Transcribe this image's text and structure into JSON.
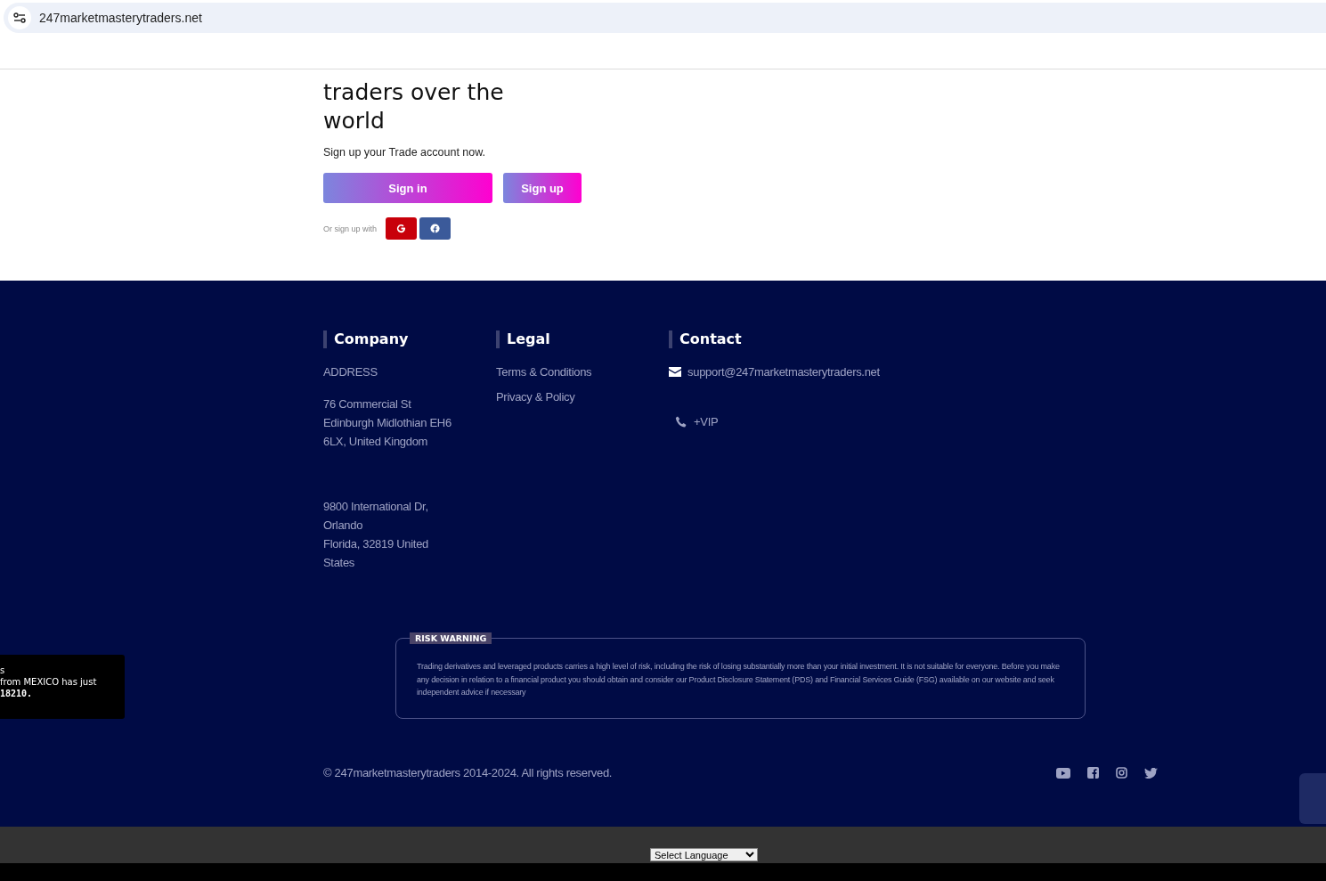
{
  "browser": {
    "url": "247marketmasterytraders.net"
  },
  "hero": {
    "heading_lines": [
      "traders over the",
      "world"
    ],
    "subtitle": "Sign up your Trade account now.",
    "buttons": [
      "Sign in",
      "Sign up"
    ],
    "social_label": "Or sign up with"
  },
  "footer": {
    "company": {
      "title": "Company",
      "address_label": "ADDRESS",
      "addresses": [
        [
          "76 Commercial St",
          "Edinburgh Midlothian EH6",
          "6LX, United Kingdom"
        ],
        [
          "9800 International Dr,",
          "Orlando",
          "Florida, 32819 United",
          "States"
        ]
      ]
    },
    "legal": {
      "title": "Legal",
      "links": [
        "Terms & Conditions",
        "Privacy & Policy"
      ]
    },
    "contact": {
      "title": "Contact",
      "email": "support@247marketmasterytraders.net",
      "phone": "+VIP"
    },
    "risk": {
      "title": "RISK WARNING",
      "text": "Trading derivatives and leveraged products carries a high level of risk, including the risk of losing substantially more than your initial investment. It is not suitable for everyone. Before you make any decision in relation to a financial product you should obtain and consider our Product Disclosure Statement (PDS) and Financial Services Guide (FSG) available on our website and seek independent advice if necessary"
    },
    "copyright": "© 247marketmasterytraders 2014-2024. All rights reserved."
  },
  "popup": {
    "lines": [
      "s",
      "from MEXICO has just",
      "18210."
    ]
  },
  "language_select": {
    "value": "Select Language"
  }
}
